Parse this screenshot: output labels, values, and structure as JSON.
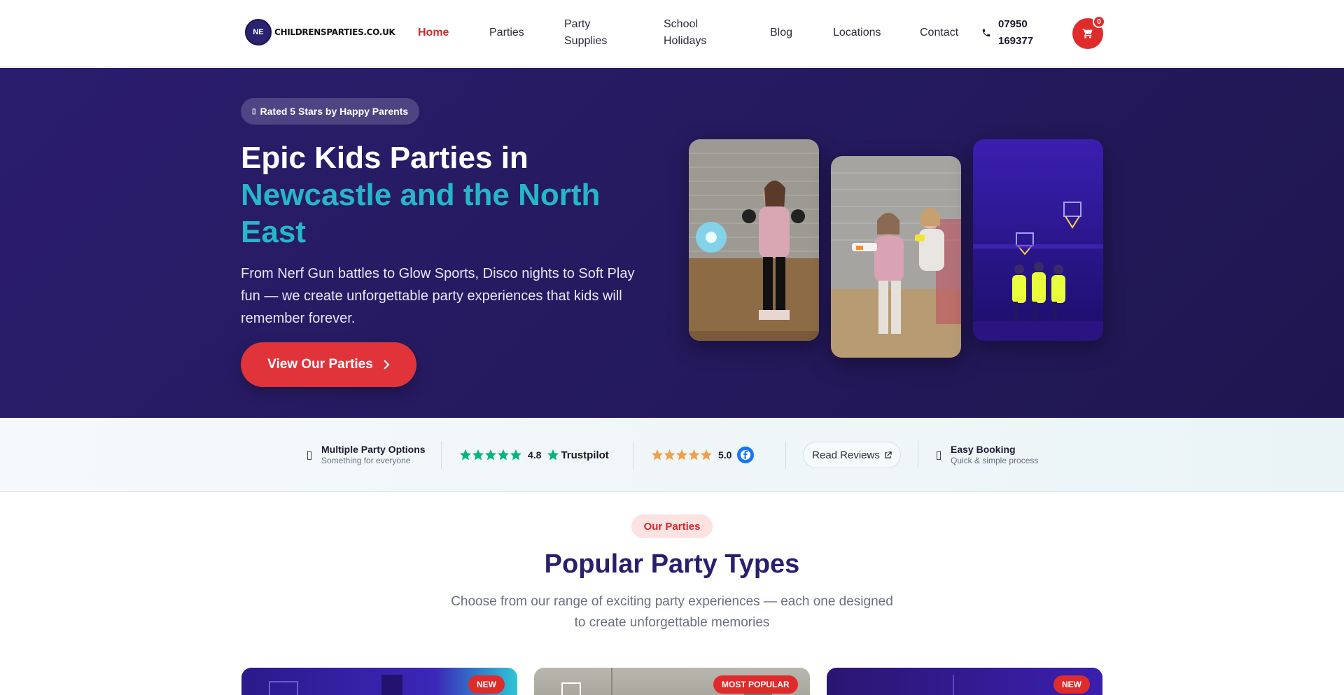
{
  "header": {
    "logo_text": "CHILDRENSPARTIES.CO.UK",
    "logo_badge": "NE",
    "nav": [
      {
        "label": "Home",
        "active": true
      },
      {
        "label": "Parties",
        "active": false
      },
      {
        "label": "Party Supplies",
        "active": false
      },
      {
        "label": "School Holidays",
        "active": false
      },
      {
        "label": "Blog",
        "active": false
      },
      {
        "label": "Locations",
        "active": false
      },
      {
        "label": "Contact",
        "active": false
      }
    ],
    "phone": "07950 169377",
    "cart_count": "0"
  },
  "hero": {
    "badge": "Rated 5 Stars by Happy Parents",
    "title_line": "Epic Kids Parties in",
    "title_accent": "Newcastle and the North East",
    "subtitle": "From Nerf Gun battles to Glow Sports, Disco nights to Soft Play fun — we create unforgettable party experiences that kids will remember forever.",
    "cta": "View Our Parties"
  },
  "trust_bar": {
    "options_title": "Multiple Party Options",
    "options_sub": "Something for everyone",
    "trustpilot_rating": "4.8",
    "trustpilot_label": "Trustpilot",
    "facebook_rating": "5.0",
    "read_reviews": "Read Reviews",
    "booking_title": "Easy Booking",
    "booking_sub": "Quick & simple process"
  },
  "section": {
    "pill": "Our Parties",
    "title": "Popular Party Types",
    "subtitle": "Choose from our range of exciting party experiences — each one designed to create unforgettable memories"
  },
  "cards": [
    {
      "tag": "NEW"
    },
    {
      "tag": "MOST POPULAR"
    },
    {
      "tag": "NEW"
    }
  ],
  "colors": {
    "brand_red": "#e0343a",
    "hero_bg": "#2b1d6e",
    "accent_teal": "#27b6c8",
    "trustpilot_green": "#00b67a",
    "facebook_blue": "#1877f2",
    "star_orange": "#f0a04b"
  }
}
